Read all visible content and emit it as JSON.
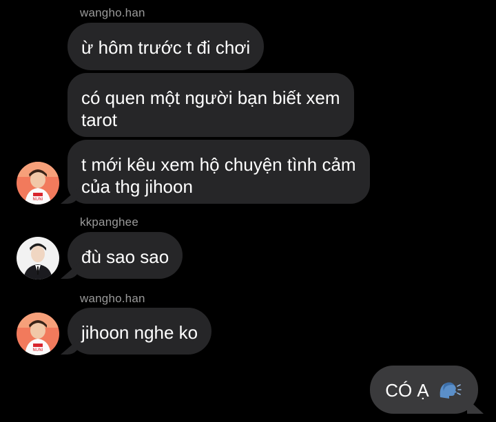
{
  "thread": {
    "messages": [
      {
        "sender": "wangho.han",
        "text": "ừ hôm trước t đi chơi"
      },
      {
        "text": "có quen một người bạn biết xem"
      },
      {
        "text": "tarot"
      },
      {
        "text": "t mới kêu xem hộ chuyện tình cảm"
      },
      {
        "text": "của thg jihoon"
      },
      {
        "sender": "kkpanghee",
        "text": "đù sao sao"
      },
      {
        "sender": "wangho.han",
        "text": "jihoon nghe ko"
      },
      {
        "text": "CÓ Ạ"
      }
    ]
  },
  "colors": {
    "background": "#000000",
    "incoming_bubble": "#262628",
    "outgoing_bubble": "#3a3a3c",
    "sender_label": "#9a9a9a"
  },
  "icons": {
    "avatar_wangho": "avatar-icon",
    "avatar_kkpanghee": "avatar-icon",
    "emoji": "speaking-head-emoji-icon"
  }
}
